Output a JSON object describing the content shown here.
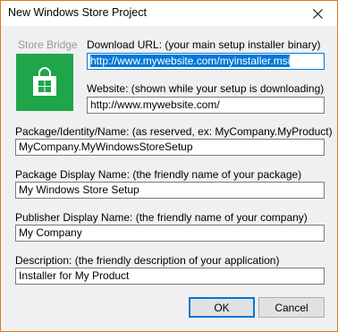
{
  "window": {
    "title": "New Windows Store Project",
    "close_glyph": "close-icon"
  },
  "logo": {
    "caption": "Store Bridge",
    "icon": "shopping-bag-windows-icon",
    "tile_color": "#1fa64a"
  },
  "fields": {
    "download_url": {
      "label": "Download URL: (your main setup installer binary)",
      "value": "http://www.mywebsite.com/myinstaller.msi"
    },
    "website": {
      "label": "Website: (shown while your setup is downloading)",
      "value": "http://www.mywebsite.com/"
    },
    "package_identity_name": {
      "label": "Package/Identity/Name: (as reserved, ex: MyCompany.MyProduct)",
      "value": "MyCompany.MyWindowsStoreSetup"
    },
    "package_display_name": {
      "label": "Package Display Name: (the friendly name of your package)",
      "value": "My Windows Store Setup"
    },
    "publisher_display_name": {
      "label": "Publisher Display Name: (the friendly name of your company)",
      "value": "My Company"
    },
    "description": {
      "label": "Description: (the friendly description of your application)",
      "value": "Installer for My Product"
    }
  },
  "buttons": {
    "ok": "OK",
    "cancel": "Cancel"
  },
  "colors": {
    "accent": "#0078d7",
    "window_border": "#d87b16"
  }
}
